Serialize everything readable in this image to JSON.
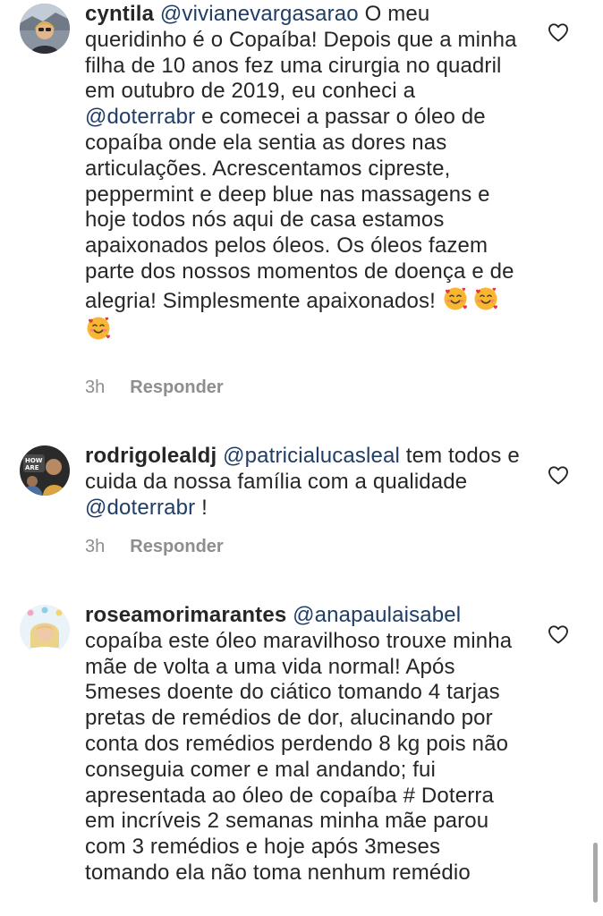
{
  "comments": [
    {
      "username": "cyntila",
      "mention": "@vivianevargasarao",
      "text_1": " O meu queridinho é o Copaíba! Depois que a minha filha de 10 anos fez uma cirurgia no quadril em outubro de 2019, eu conheci a ",
      "mention_2": "@doterrabr",
      "text_2": " e comecei a passar o óleo de copaíba onde ela sentia as dores nas articulações. Acrescentamos cipreste, peppermint e deep blue nas massagens e hoje todos nós aqui de casa estamos apaixonados pelos óleos. Os óleos fazem parte dos nossos momentos de doença e de alegria! Simplesmente apaixonados!",
      "emoji": "smiling-face-with-hearts",
      "emoji_count": 3,
      "time": "3h",
      "reply_label": "Responder"
    },
    {
      "username": "rodrigolealdj",
      "mention": "@patricialucasleal",
      "text_1": " tem todos e cuida da nossa família com a qualidade ",
      "mention_2": "@doterrabr",
      "text_2": " !",
      "time": "3h",
      "reply_label": "Responder"
    },
    {
      "username": "roseamorimarantes",
      "mention": "@anapaulaisabel",
      "text_1": " copaíba este óleo  maravilhoso trouxe minha mãe de volta a uma vida normal! Após 5meses doente do ciático tomando 4 tarjas pretas de remédios de dor, alucinando por conta dos remédios perdendo 8 kg pois não conseguia comer  e mal andando; fui apresentada ao óleo  de copaíba # Doterra  em incríveis  2 semanas minha mãe  parou com 3 remédios  e hoje após  3meses tomando  ela não  toma nenhum remédio"
    }
  ],
  "icons": {
    "like": "heart-outline-icon",
    "emoji": "smiling-face-with-hearts"
  },
  "colors": {
    "text": "#262626",
    "mention": "#1f3d66",
    "meta": "#8e8e8e"
  }
}
